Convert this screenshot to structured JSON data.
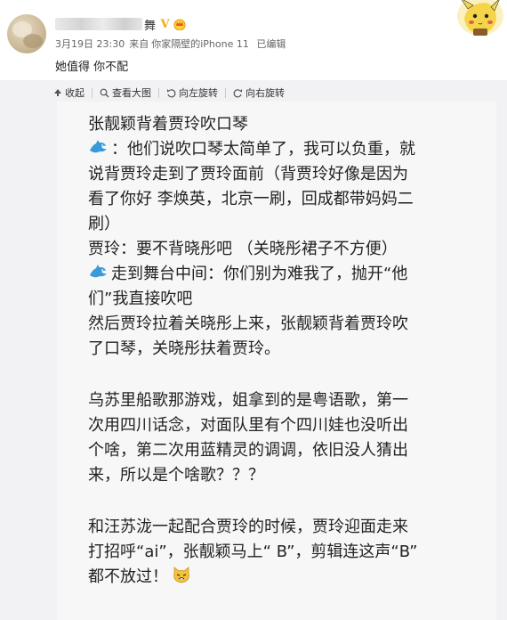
{
  "header": {
    "name_visible": "舞",
    "verified_badge": "V",
    "meta": {
      "time": "3月19日 23:30",
      "source_prefix": "来自",
      "source": "你家隔壁的iPhone 11",
      "edited": "已编辑"
    },
    "post_text": "她值得 你不配"
  },
  "toolbar": {
    "collapse": "收起",
    "view_large": "查看大图",
    "rotate_left": "向左旋转",
    "rotate_right": "向右旋转"
  },
  "image_text": {
    "lines": [
      "张靓颖背着贾玲吹口琴",
      "：他们说吹口琴太简单了，我可以负重，就",
      "说背贾玲走到了贾玲面前（背贾玲好像是因为",
      "看了你好 李焕英，北京一刷，回成都带妈妈二",
      "刷）",
      "贾玲：要不背晓彤吧 （关晓彤裙子不方便）",
      "走到舞台中间：你们别为难我了，抛开“他",
      "们”我直接吹吧",
      "然后贾玲拉着关晓彤上来，张靓颖背着贾玲吹",
      "了口琴，关晓彤扶着贾玲。",
      "乌苏里船歌那游戏，姐拿到的是粤语歌，第一",
      "次用四川话念，对面队里有个四川娃也没听出",
      "个啥，第二次用蓝精灵的调调，依旧没人猜出",
      "来，所以是个啥歌？？？",
      "和汪苏泷一起配合贾玲的时候，贾玲迎面走来",
      "打招呼“ai”，张靓颖马上“ B”，剪辑连这声“B”",
      "都不放过！"
    ]
  },
  "colors": {
    "accent_orange": "#f3a90b",
    "gray_bg": "#f2f2f5",
    "dolphin_blue": "#3a9ad9"
  },
  "icons": [
    "collapse-icon",
    "magnifier-icon",
    "rotate-left-icon",
    "rotate-right-icon",
    "dolphin-emoji-icon",
    "cat-emoji-icon",
    "crown-icon",
    "pikachu-sticker"
  ]
}
